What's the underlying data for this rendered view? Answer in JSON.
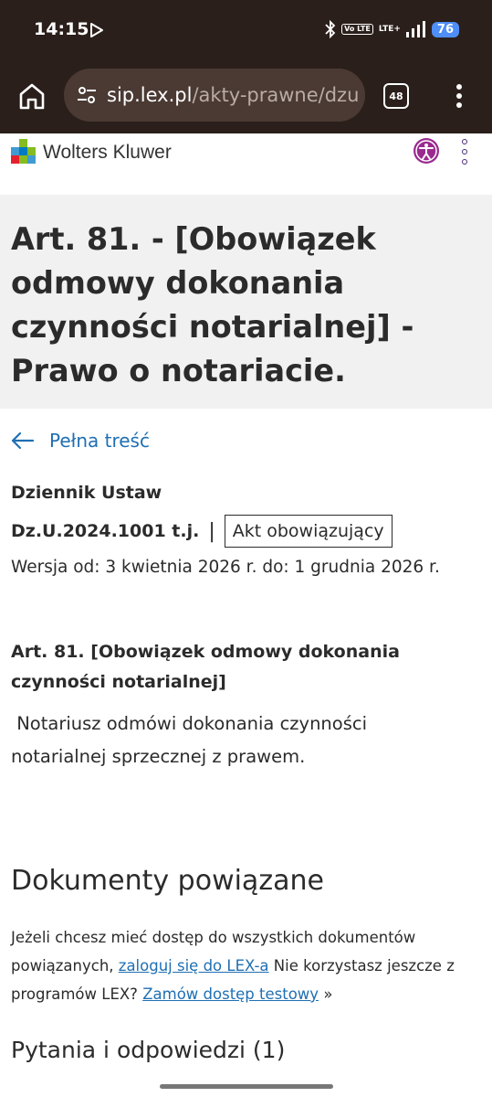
{
  "status_bar": {
    "time": "14:15",
    "volte": "Vo LTE",
    "lte": "LTE+",
    "battery": "76"
  },
  "browser": {
    "url_domain": "sip.lex.pl",
    "url_path": "/akty-prawne/dzu",
    "tab_count": "48"
  },
  "site": {
    "brand": "Wolters Kluwer",
    "logo_colors": [
      "#85bc20",
      "#007ac3",
      "#e5202e",
      "#409bd2"
    ],
    "accent": "#9b2a8f"
  },
  "page": {
    "title": "Art. 81. - [Obowiązek odmowy dokonania czynności notarialnej] - Prawo o notariacie.",
    "back_label": "Pełna treść",
    "publisher": "Dziennik Ustaw",
    "dz_id": "Dz.U.2024.1001 t.j.",
    "separator": "|",
    "status": "Akt obowiązujący",
    "version": "Wersja od: 3 kwietnia 2026 r. do: 1 grudnia 2026 r."
  },
  "article": {
    "heading": "Art.  81. [Obowiązek odmowy dokonania czynności notarialnej]",
    "body": " Notariusz odmówi dokonania czynności notarialnej sprzecznej z prawem."
  },
  "related": {
    "title": "Dokumenty powiązane",
    "text_before": "Jeżeli chcesz mieć dostęp do wszystkich dokumentów powiązanych, ",
    "login_link": "zaloguj się do LEX-a",
    "text_middle": " Nie korzystasz jeszcze z programów LEX? ",
    "trial_link": "Zamów dostęp testowy",
    "text_after": " »"
  },
  "qa": {
    "title": "Pytania i odpowiedzi (1)"
  }
}
